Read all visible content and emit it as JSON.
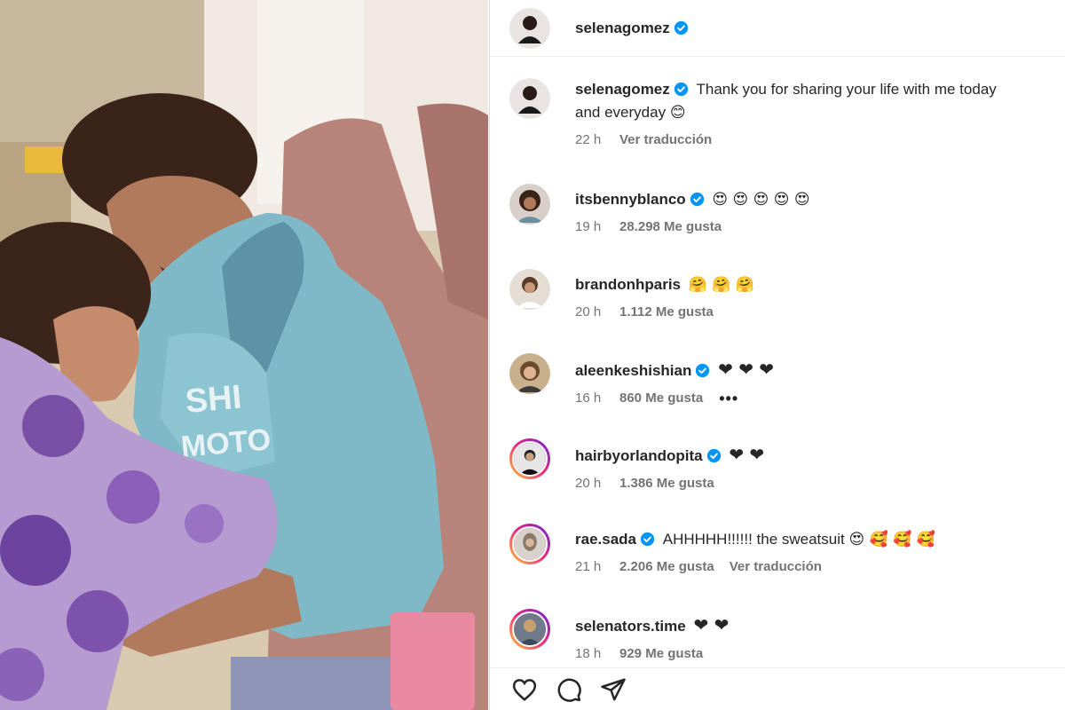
{
  "post": {
    "author": "selenagomez",
    "caption_user": "selenagomez",
    "caption_text": "Thank you for sharing your life with me today",
    "caption_text2": "and everyday",
    "caption_emoji": "😊",
    "caption_time": "22 h",
    "caption_translate": "Ver traducción"
  },
  "comments": [
    {
      "user": "itsbennyblanco",
      "verified": true,
      "text": "",
      "emojis": "😍 😍 😍 😍 😍",
      "time": "19 h",
      "likes": "28.298 Me gusta",
      "translate": "",
      "ring": false
    },
    {
      "user": "brandonhparis",
      "verified": false,
      "text": "",
      "emojis": "🤗 🤗 🤗",
      "time": "20 h",
      "likes": "1.112 Me gusta",
      "translate": "",
      "ring": false
    },
    {
      "user": "aleenkeshishian",
      "verified": true,
      "text": "",
      "emojis": "❤ ❤ ❤",
      "time": "16 h",
      "likes": "860 Me gusta",
      "translate": "",
      "ring": false,
      "more": "•••"
    },
    {
      "user": "hairbyorlandopita",
      "verified": true,
      "text": "",
      "emojis": "❤ ❤",
      "time": "20 h",
      "likes": "1.386 Me gusta",
      "translate": "",
      "ring": true
    },
    {
      "user": "rae.sada",
      "verified": true,
      "text": "AHHHHH!!!!!! the sweatsuit",
      "emojis": "😍 🥰 🥰 🥰",
      "time": "21 h",
      "likes": "2.206 Me gusta",
      "translate": "Ver traducción",
      "ring": true
    },
    {
      "user": "selenators.time",
      "verified": false,
      "text": "",
      "emojis": "❤ ❤",
      "time": "18 h",
      "likes": "929 Me gusta",
      "translate": "",
      "ring": true
    }
  ],
  "icons": {
    "like": "heart-outline-icon",
    "comment": "comment-bubble-icon",
    "share": "paper-plane-icon",
    "verified": "verified-badge-icon"
  },
  "colors": {
    "verified": "#0095f6",
    "heart": "#ed1c3a",
    "meta_text": "#737373"
  }
}
